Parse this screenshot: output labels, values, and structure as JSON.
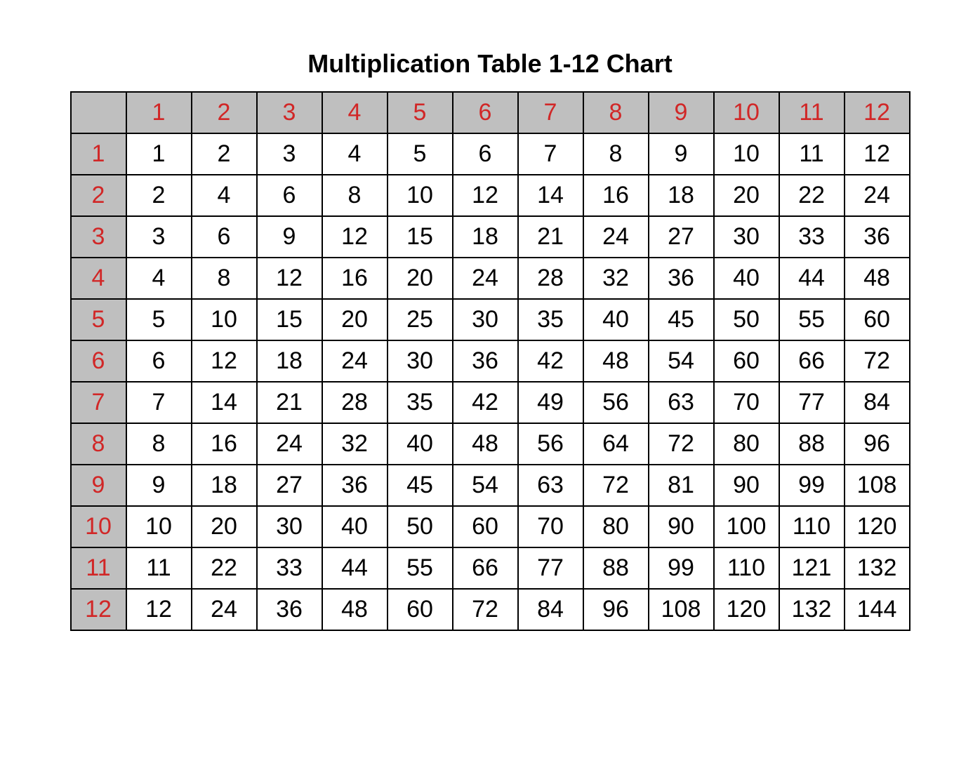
{
  "title": "Multiplication Table 1-12 Chart",
  "chart_data": {
    "type": "table",
    "title": "Multiplication Table 1-12 Chart",
    "col_headers": [
      1,
      2,
      3,
      4,
      5,
      6,
      7,
      8,
      9,
      10,
      11,
      12
    ],
    "row_headers": [
      1,
      2,
      3,
      4,
      5,
      6,
      7,
      8,
      9,
      10,
      11,
      12
    ],
    "values": [
      [
        1,
        2,
        3,
        4,
        5,
        6,
        7,
        8,
        9,
        10,
        11,
        12
      ],
      [
        2,
        4,
        6,
        8,
        10,
        12,
        14,
        16,
        18,
        20,
        22,
        24
      ],
      [
        3,
        6,
        9,
        12,
        15,
        18,
        21,
        24,
        27,
        30,
        33,
        36
      ],
      [
        4,
        8,
        12,
        16,
        20,
        24,
        28,
        32,
        36,
        40,
        44,
        48
      ],
      [
        5,
        10,
        15,
        20,
        25,
        30,
        35,
        40,
        45,
        50,
        55,
        60
      ],
      [
        6,
        12,
        18,
        24,
        30,
        36,
        42,
        48,
        54,
        60,
        66,
        72
      ],
      [
        7,
        14,
        21,
        28,
        35,
        42,
        49,
        56,
        63,
        70,
        77,
        84
      ],
      [
        8,
        16,
        24,
        32,
        40,
        48,
        56,
        64,
        72,
        80,
        88,
        96
      ],
      [
        9,
        18,
        27,
        36,
        45,
        54,
        63,
        72,
        81,
        90,
        99,
        108
      ],
      [
        10,
        20,
        30,
        40,
        50,
        60,
        70,
        80,
        90,
        100,
        110,
        120
      ],
      [
        11,
        22,
        33,
        44,
        55,
        66,
        77,
        88,
        99,
        110,
        121,
        132
      ],
      [
        12,
        24,
        36,
        48,
        60,
        72,
        84,
        96,
        108,
        120,
        132,
        144
      ]
    ]
  },
  "colors": {
    "header_bg": "#bfbfbf",
    "header_fg": "#d12727",
    "cell_bg": "#ffffff",
    "cell_fg": "#000000"
  }
}
